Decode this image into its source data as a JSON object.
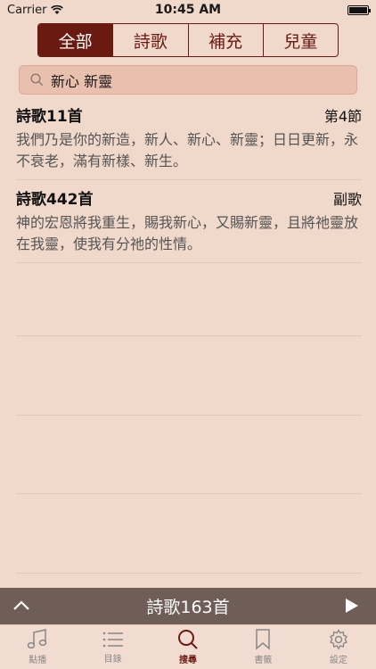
{
  "status": {
    "carrier": "Carrier",
    "time": "10:45 AM"
  },
  "segments": [
    {
      "label": "全部",
      "active": true
    },
    {
      "label": "詩歌",
      "active": false
    },
    {
      "label": "補充",
      "active": false
    },
    {
      "label": "兒童",
      "active": false
    }
  ],
  "search": {
    "query": "新心 新靈"
  },
  "results": [
    {
      "title": "詩歌11首",
      "tag": "第4節",
      "text": "我們乃是你的新造，新人、新心、新靈；日日更新，永不衰老，滿有新樣、新生。"
    },
    {
      "title": "詩歌442首",
      "tag": "副歌",
      "text": "神的宏恩將我重生，賜我新心，又賜新靈，且將祂靈放在我靈，使我有分祂的性情。"
    }
  ],
  "player": {
    "title": "詩歌163首"
  },
  "tabs": [
    {
      "label": "點播",
      "icon": "music-note-icon"
    },
    {
      "label": "目錄",
      "icon": "list-icon"
    },
    {
      "label": "搜尋",
      "icon": "search-icon",
      "active": true
    },
    {
      "label": "書籤",
      "icon": "bookmark-icon"
    },
    {
      "label": "設定",
      "icon": "gear-icon"
    }
  ],
  "colors": {
    "accent": "#6b1a12",
    "background": "#f0d8cb",
    "player": "#6f5d57"
  }
}
